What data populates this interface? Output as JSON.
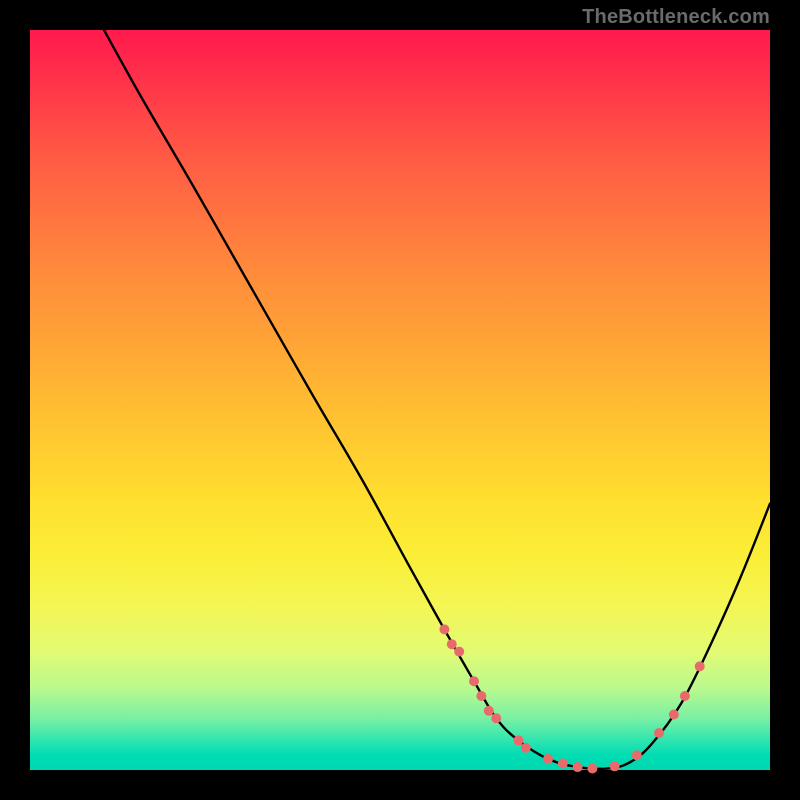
{
  "watermark": "TheBottleneck.com",
  "chart_data": {
    "type": "line",
    "title": "",
    "xlabel": "",
    "ylabel": "",
    "xlim": [
      0,
      100
    ],
    "ylim": [
      0,
      100
    ],
    "series": [
      {
        "name": "curve",
        "x": [
          10,
          15,
          22,
          30,
          38,
          45,
          51,
          56,
          60,
          63,
          66,
          70,
          74,
          78,
          81,
          84,
          88,
          92,
          96,
          100
        ],
        "y": [
          100,
          91,
          79,
          65,
          51,
          39,
          28,
          19,
          12,
          7,
          4,
          1.5,
          0.4,
          0.2,
          1.0,
          3.5,
          9,
          17,
          26,
          36
        ]
      }
    ],
    "markers": [
      {
        "x": 56,
        "y": 19,
        "r": 5
      },
      {
        "x": 57,
        "y": 17,
        "r": 5
      },
      {
        "x": 58,
        "y": 16,
        "r": 5
      },
      {
        "x": 60,
        "y": 12,
        "r": 5
      },
      {
        "x": 61,
        "y": 10,
        "r": 5
      },
      {
        "x": 62,
        "y": 8,
        "r": 5
      },
      {
        "x": 63,
        "y": 7,
        "r": 5
      },
      {
        "x": 66,
        "y": 4,
        "r": 5
      },
      {
        "x": 67,
        "y": 3,
        "r": 5
      },
      {
        "x": 70,
        "y": 1.5,
        "r": 5
      },
      {
        "x": 72,
        "y": 0.9,
        "r": 5
      },
      {
        "x": 74,
        "y": 0.4,
        "r": 5
      },
      {
        "x": 76,
        "y": 0.2,
        "r": 5
      },
      {
        "x": 79,
        "y": 0.5,
        "r": 5
      },
      {
        "x": 82,
        "y": 2.0,
        "r": 5
      },
      {
        "x": 85,
        "y": 5.0,
        "r": 5
      },
      {
        "x": 87,
        "y": 7.5,
        "r": 5
      },
      {
        "x": 88.5,
        "y": 10,
        "r": 5
      },
      {
        "x": 90.5,
        "y": 14,
        "r": 5
      }
    ],
    "colors": {
      "curve": "#000000",
      "marker_fill": "#e86b6b",
      "marker_stroke": "#d85a5a"
    }
  }
}
